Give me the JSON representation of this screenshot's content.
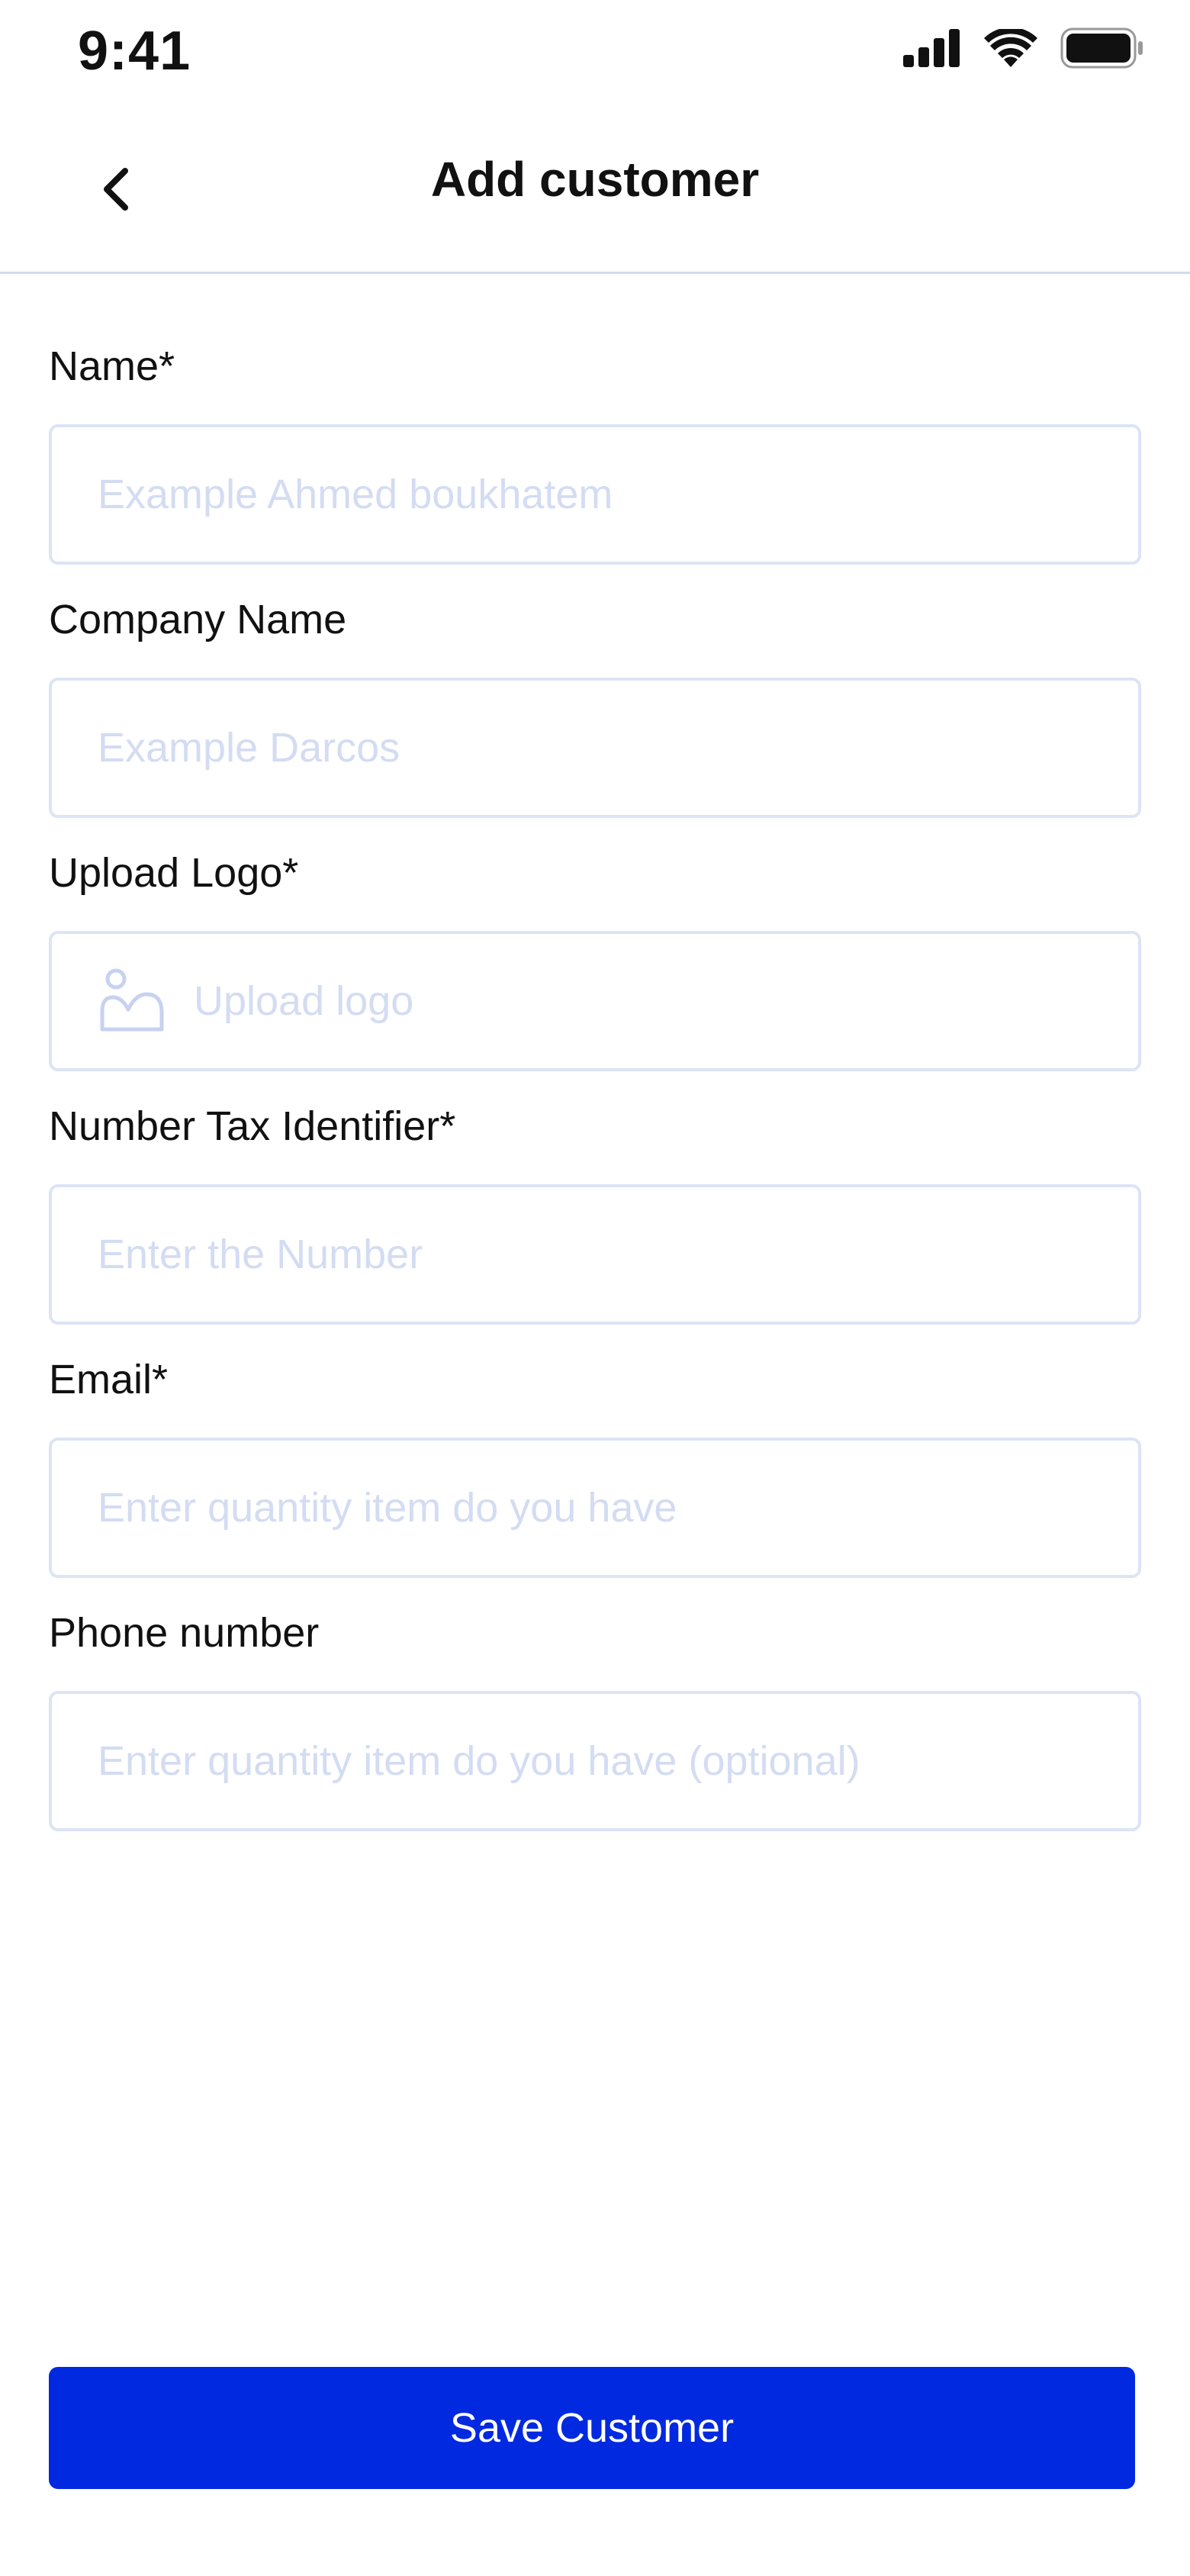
{
  "status_bar": {
    "time": "9:41",
    "icons": [
      "cellular-signal-icon",
      "wifi-icon",
      "battery-icon"
    ]
  },
  "header": {
    "title": "Add customer",
    "back_icon": "chevron-left-icon"
  },
  "form": {
    "fields": [
      {
        "label": "Name*",
        "placeholder": "Example Ahmed boukhatem",
        "value": ""
      },
      {
        "label": "Company Name",
        "placeholder": "Example Darcos",
        "value": ""
      },
      {
        "label": "Upload Logo*",
        "placeholder": "Upload logo",
        "icon": "image-icon"
      },
      {
        "label": "Number Tax Identifier*",
        "placeholder": "Enter the Number",
        "value": ""
      },
      {
        "label": "Email*",
        "placeholder": "Enter quantity item do you have",
        "value": ""
      },
      {
        "label": "Phone number",
        "placeholder": "Enter quantity item do you have (optional)",
        "value": ""
      }
    ]
  },
  "save_button": {
    "label": "Save Customer"
  },
  "colors": {
    "primary": "#0029e0",
    "placeholder": "#d3dcf2",
    "input_border": "#dce4f5",
    "divider": "#d3dbe8",
    "text": "#111111"
  }
}
